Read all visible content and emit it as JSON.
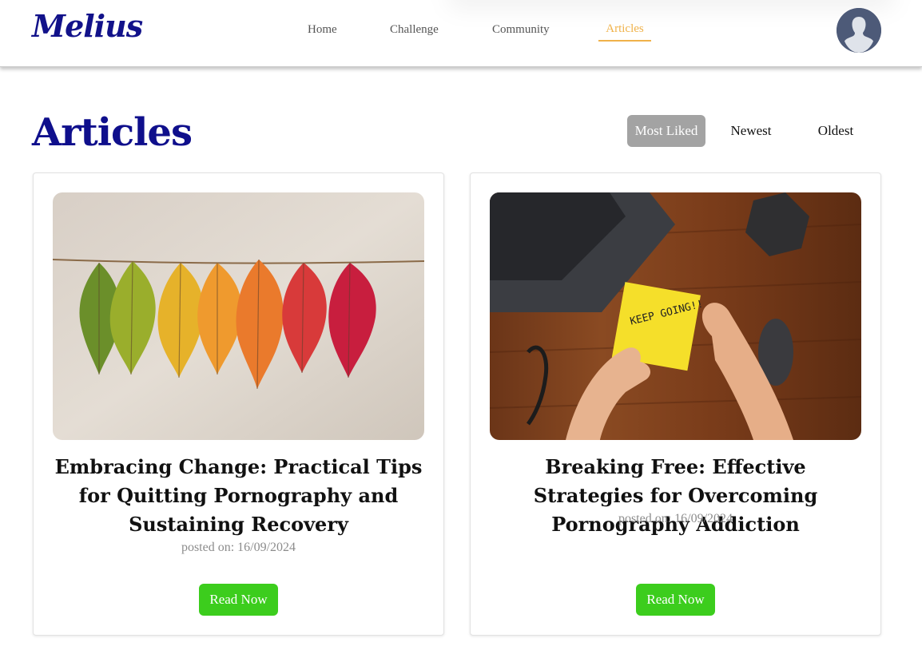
{
  "brand": {
    "logo_text": "Melius"
  },
  "nav": {
    "items": [
      {
        "label": "Home"
      },
      {
        "label": "Challenge"
      },
      {
        "label": "Community"
      },
      {
        "label": "Articles"
      }
    ],
    "active": "Articles"
  },
  "page": {
    "title": "Articles"
  },
  "sort": {
    "options": [
      {
        "label": "Most Liked"
      },
      {
        "label": "Newest"
      },
      {
        "label": "Oldest"
      }
    ],
    "selected": "Most Liked"
  },
  "articles": [
    {
      "title": "Embracing Change: Practical Tips for Quitting Pornography and Sustaining Recovery",
      "date": "posted on: 16/09/2024",
      "button": "Read Now",
      "image": "autumn-leaves-on-string"
    },
    {
      "title": "Breaking Free: Effective Strategies for Overcoming Pornography Addiction",
      "date": "posted on: 16/09/2024",
      "button": "Read Now",
      "image": "hands-holding-keep-going-note",
      "note_text": "KEEP GOING!!"
    }
  ],
  "colors": {
    "brand": "#12128a",
    "title": "#0f0f8c",
    "nav_active": "#f0b24a",
    "sort_selected_bg": "#a3a3a3",
    "read_button": "#3ccd1d"
  }
}
